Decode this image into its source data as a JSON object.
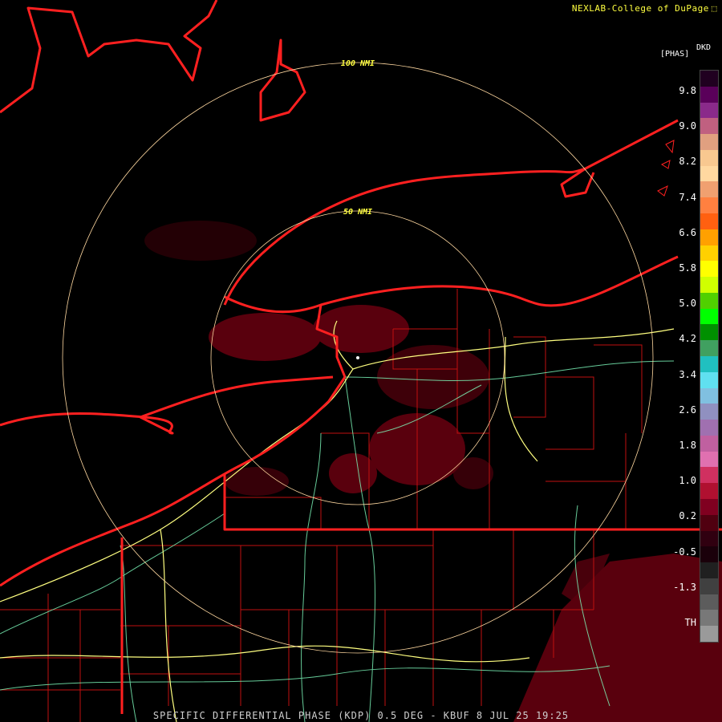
{
  "header": {
    "credit": "NEXLAB-College of DuPage",
    "logo_icon": "cod-logo-icon"
  },
  "legend": {
    "product": "DKD",
    "units": "[PHAS]",
    "ticks": [
      "9.8",
      "9.0",
      "8.2",
      "7.4",
      "6.6",
      "5.8",
      "5.0",
      "4.2",
      "3.4",
      "2.6",
      "1.8",
      "1.0",
      "0.2",
      "-0.5",
      "-1.3",
      "TH"
    ],
    "colors": [
      "#200020",
      "#5a005a",
      "#8a2a8a",
      "#c06080",
      "#e0a080",
      "#f8c890",
      "#ffd8a0",
      "#f0a070",
      "#ff8040",
      "#ff6010",
      "#ffa000",
      "#ffd000",
      "#ffff00",
      "#d0ff00",
      "#50d000",
      "#00ff00",
      "#009000",
      "#40a060",
      "#20c0c0",
      "#60e0f0",
      "#80c0e0",
      "#9090c0",
      "#a070b0",
      "#c060a0",
      "#e070b0",
      "#d03060",
      "#b01030",
      "#800020",
      "#500010",
      "#300010",
      "#1a000a",
      "#202020",
      "#404040",
      "#5c5c5c",
      "#787878",
      "#9a9a9a"
    ]
  },
  "range_rings": [
    {
      "label": "100 NMI",
      "miles": 100
    },
    {
      "label": "50 NMI",
      "miles": 50
    }
  ],
  "footer": {
    "caption": "SPECIFIC DIFFERENTIAL PHASE (KDP) 0.5 DEG - KBUF 8 JUL 25 19:25"
  },
  "colors": {
    "state_border": "#ff2020",
    "county_border": "#c01010",
    "interstate": "#ffff80",
    "highway": "#80ffc0",
    "ring": "#ffd8a0",
    "ring_label": "#ffff40",
    "echo": "#6a0010"
  }
}
